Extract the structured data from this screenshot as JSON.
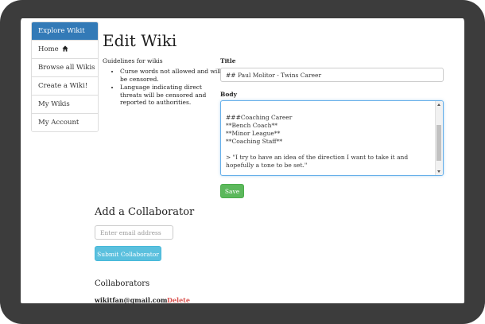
{
  "sidebar": {
    "items": [
      {
        "label": "Explore Wikit"
      },
      {
        "label": "Home"
      },
      {
        "label": "Browse all Wikis"
      },
      {
        "label": "Create a Wiki!"
      },
      {
        "label": "My Wikis"
      },
      {
        "label": "My Account"
      }
    ]
  },
  "page": {
    "title": "Edit Wiki",
    "guidelines_title": "Guidelines for wikis",
    "guidelines": [
      "Curse words not allowed and will be censored.",
      "Language indicating direct threats will be censored and reported to authorities."
    ]
  },
  "form": {
    "title_label": "Title",
    "title_value": "## Paul Molitor - Twins Career",
    "body_label": "Body",
    "body_value": "###Coaching Career\n**Bench Coach**\n**Minor League**\n**Coaching Staff**\n\n> \"I try to have an idea of the direction I want to take it and hopefully a tone to be set.\"",
    "save_label": "Save"
  },
  "collaborators": {
    "add_heading": "Add a Collaborator",
    "email_placeholder": "Enter email address",
    "submit_label": "Submit Collaborator",
    "list_heading": "Collaborators",
    "list": [
      {
        "email": "wikitfan@gmail.com",
        "action": "Delete"
      }
    ]
  },
  "colors": {
    "sidebar_active": "#337ab7",
    "save": "#5cb85c",
    "submit": "#5bc0de",
    "delete": "#d9534f"
  }
}
